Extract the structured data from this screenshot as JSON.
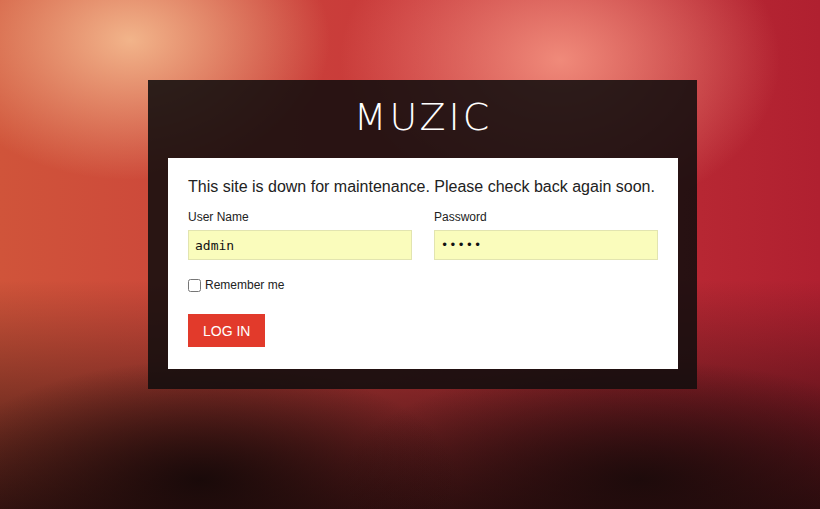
{
  "logo": {
    "text": "MUZIC"
  },
  "form": {
    "message": "This site is down for maintenance. Please check back again soon.",
    "fields": [
      {
        "label": "User Name",
        "value": "admin",
        "kind": "text"
      },
      {
        "label": "Password",
        "value": "•••••",
        "kind": "password"
      }
    ],
    "remember": {
      "label": "Remember me",
      "checked": false
    },
    "button": "LOG IN"
  }
}
